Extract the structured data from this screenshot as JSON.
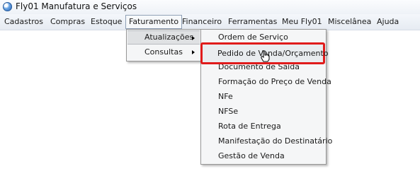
{
  "window": {
    "title": "Fly01 Manufatura e Serviços"
  },
  "menubar": {
    "items": [
      "Cadastros",
      "Compras",
      "Estoque",
      "Faturamento",
      "Financeiro",
      "Ferramentas",
      "Meu Fly01",
      "Miscelânea",
      "Ajuda"
    ]
  },
  "faturamento_menu": {
    "items": [
      {
        "label": "Atualizações",
        "has_submenu": true
      },
      {
        "label": "Consultas",
        "has_submenu": true
      }
    ]
  },
  "atualizacoes_submenu": {
    "items": [
      "Ordem de Serviço",
      "Pedido de Venda/Orçamento",
      "Documento de Saída",
      "Formação do Preço de Venda",
      "NFe",
      "NFSe",
      "Rota de Entrega",
      "Manifestação do Destinatário",
      "Gestão de Venda"
    ]
  },
  "colors": {
    "highlight_border": "#e01b1b",
    "menu_bg": "#f5f6f7"
  },
  "icons": {
    "app": "globe-icon",
    "submenu": "chevron-right-icon",
    "pointer": "hand-cursor-icon"
  }
}
